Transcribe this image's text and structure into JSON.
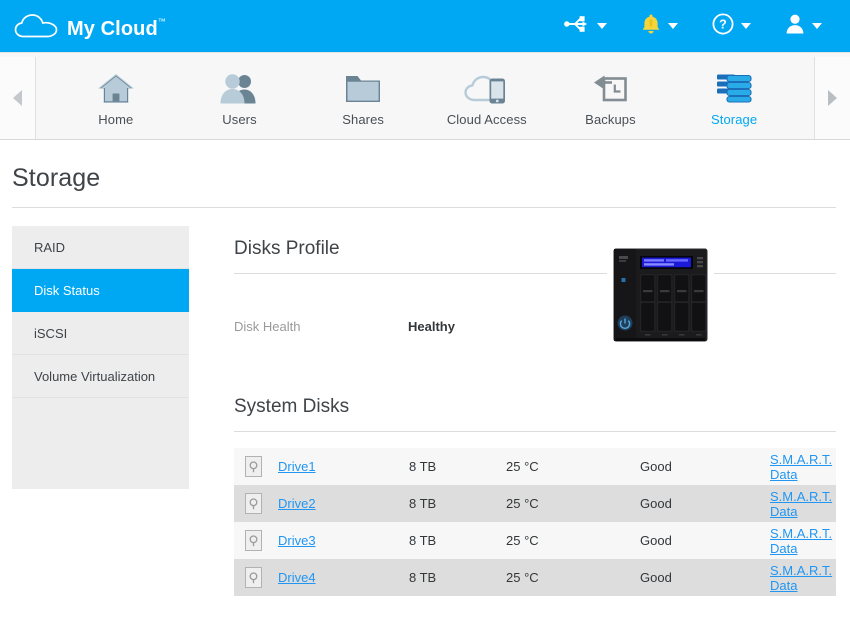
{
  "header": {
    "brand": "My Cloud",
    "trademark": "™",
    "logo_icon": "cloud-icon",
    "tools": [
      {
        "icon": "usb-icon",
        "label": "USB Devices",
        "caret": "chevron-down-icon"
      },
      {
        "icon": "bell-icon",
        "label": "Alerts",
        "caret": "chevron-down-icon"
      },
      {
        "icon": "help-icon",
        "label": "Help",
        "caret": "chevron-down-icon"
      },
      {
        "icon": "user-account-icon",
        "label": "User Account",
        "caret": "chevron-down-icon"
      }
    ]
  },
  "nav": {
    "prev_arrow_icon": "chevron-left-icon",
    "next_arrow_icon": "chevron-right-icon",
    "tabs": [
      {
        "label": "Home",
        "icon": "home-icon",
        "active": false
      },
      {
        "label": "Users",
        "icon": "users-icon",
        "active": false
      },
      {
        "label": "Shares",
        "icon": "folder-icon",
        "active": false
      },
      {
        "label": "Cloud Access",
        "icon": "cloud-mobile-icon",
        "active": false
      },
      {
        "label": "Backups",
        "icon": "backup-icon",
        "active": false
      },
      {
        "label": "Storage",
        "icon": "storage-icon",
        "active": true
      }
    ]
  },
  "page": {
    "title": "Storage"
  },
  "sidebar": {
    "items": [
      {
        "label": "RAID",
        "active": false
      },
      {
        "label": "Disk Status",
        "active": true
      },
      {
        "label": "iSCSI",
        "active": false
      },
      {
        "label": "Volume Virtualization",
        "active": false
      }
    ]
  },
  "disks_profile": {
    "heading": "Disks Profile",
    "health_label": "Disk Health",
    "health_value": "Healthy",
    "device_image_name": "nas-enclosure-image"
  },
  "system_disks": {
    "heading": "System Disks",
    "rows": [
      {
        "icon": "hdd-icon",
        "name": "Drive1",
        "size": "8 TB",
        "temperature": "25 °C",
        "status": "Good",
        "smart": "S.M.A.R.T. Data"
      },
      {
        "icon": "hdd-icon",
        "name": "Drive2",
        "size": "8 TB",
        "temperature": "25 °C",
        "status": "Good",
        "smart": "S.M.A.R.T. Data"
      },
      {
        "icon": "hdd-icon",
        "name": "Drive3",
        "size": "8 TB",
        "temperature": "25 °C",
        "status": "Good",
        "smart": "S.M.A.R.T. Data"
      },
      {
        "icon": "hdd-icon",
        "name": "Drive4",
        "size": "8 TB",
        "temperature": "25 °C",
        "status": "Good",
        "smart": "S.M.A.R.T. Data"
      }
    ]
  },
  "colors": {
    "brand_blue": "#00a8f3",
    "link_blue": "#2196f3",
    "sidebar_bg": "#ededed",
    "row_odd": "#f7f7f7",
    "row_even": "#dddddd",
    "text_dark": "#3f4448",
    "text_muted": "#9a9a9a"
  }
}
